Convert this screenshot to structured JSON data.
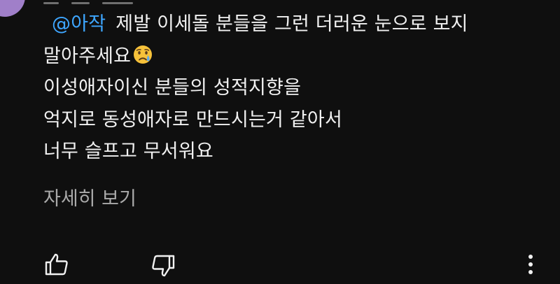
{
  "comment": {
    "mention": "@아작",
    "line1_text": "제발 이세돌 분들을 그런 더러운 눈으로 보지",
    "line2_text": "말아주세요",
    "line2_emoji_icon": "crying-face-icon",
    "line3_text": "이성애자이신 분들의 성적지향을",
    "line4_text": "억지로 동성애자로 만드시는거 같아서",
    "line5_text": "너무 슬프고 무서워요"
  },
  "read_more_label": "자세히 보기",
  "actions": {
    "like_icon": "thumbs-up-icon",
    "dislike_icon": "thumbs-down-icon",
    "more_icon": "more-vertical-icon"
  },
  "colors": {
    "background": "#0f0f0f",
    "text": "#f1f1f1",
    "mention": "#3ea6ff",
    "secondary_text": "#aaaaaa",
    "avatar": "#a07fc9"
  }
}
